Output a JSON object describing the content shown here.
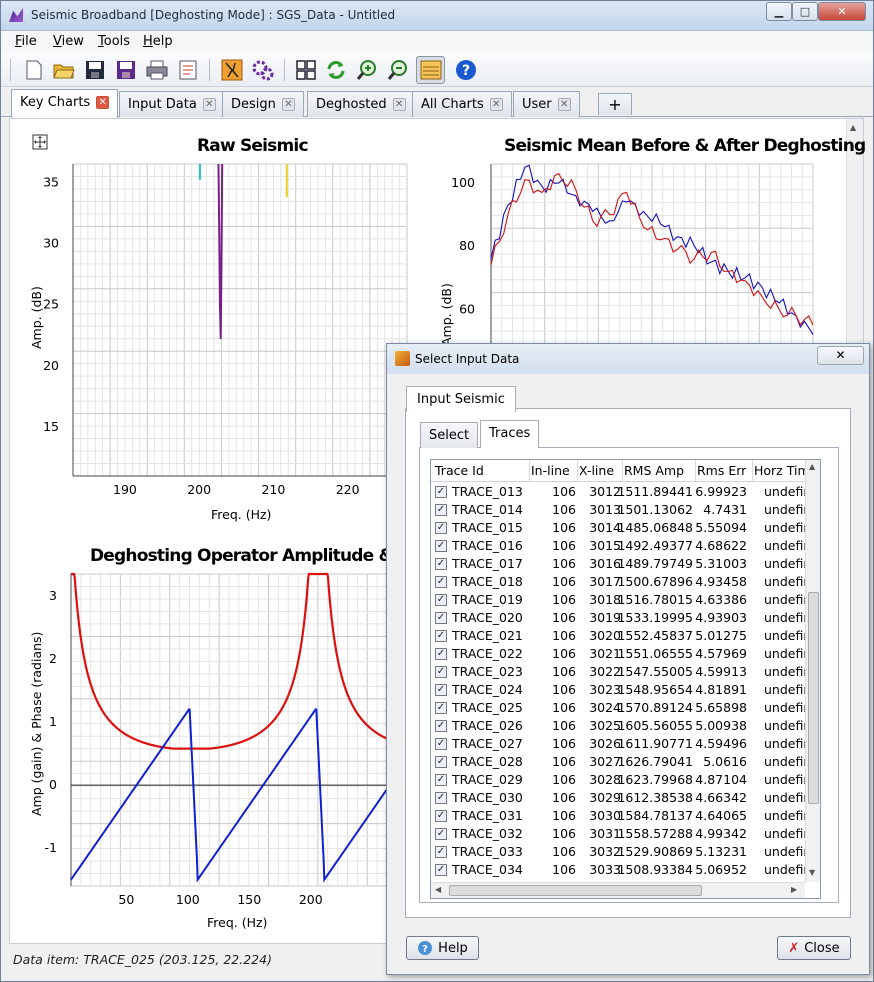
{
  "window": {
    "title": "Seismic Broadband [Deghosting Mode] : SGS_Data - Untitled",
    "min": "▁",
    "max": "□",
    "close": "✕"
  },
  "menu": [
    {
      "label": "File",
      "key": "F",
      "rest": "ile"
    },
    {
      "label": "View",
      "key": "V",
      "rest": "iew"
    },
    {
      "label": "Tools",
      "key": "T",
      "rest": "ools"
    },
    {
      "label": "Help",
      "key": "H",
      "rest": "elp"
    }
  ],
  "toolbar": {
    "icons": [
      "new-icon",
      "open-icon",
      "save-icon",
      "save-as-icon",
      "print-icon",
      "report-icon",
      "pick-icon",
      "process-icon",
      "grid-icon",
      "refresh-icon",
      "zoom-in-icon",
      "zoom-out-icon",
      "layers-icon",
      "help-icon"
    ]
  },
  "tabs": [
    {
      "label": "Key Charts",
      "active": true
    },
    {
      "label": "Input Data"
    },
    {
      "label": "Design"
    },
    {
      "label": "Deghosted"
    },
    {
      "label": "All Charts"
    },
    {
      "label": "User"
    }
  ],
  "tab_add": "+",
  "status": "Data item: TRACE_025 (203.125, 22.224)",
  "chart_data": [
    {
      "type": "line",
      "title": "Raw Seismic",
      "xlabel": "Freq. (Hz)",
      "ylabel": "Amp. (dB)",
      "xticks": [
        "190",
        "200",
        "210",
        "220"
      ],
      "yticks": [
        "15",
        "20",
        "25",
        "30",
        "35"
      ],
      "xlim": [
        183,
        228
      ],
      "ylim": [
        11,
        36.5
      ],
      "grid": true,
      "series": [
        {
          "color": "#7a1f8a",
          "x": [
            202.6,
            202.7,
            202.8,
            202.9,
            203.0,
            203.1
          ],
          "y": [
            36.5,
            31,
            25,
            22.2,
            28,
            36.5
          ]
        },
        {
          "color": "#20c0c0",
          "x": [
            200.1,
            200.1
          ],
          "y": [
            36.5,
            35.2
          ]
        },
        {
          "color": "#e8d020",
          "x": [
            211.8,
            211.8
          ],
          "y": [
            36.5,
            33.8
          ]
        }
      ]
    },
    {
      "type": "line",
      "title": "Seismic Mean Before & After Deghosting",
      "xlabel": "",
      "ylabel": "Amp. (dB)",
      "yticks": [
        "60",
        "80",
        "100"
      ],
      "ylim": [
        49,
        106
      ],
      "grid": true,
      "series": [
        {
          "color": "#1010c0",
          "y": [
            76,
            93,
            105,
            99,
            100,
            96,
            91,
            88,
            94,
            91,
            87,
            83,
            80,
            75,
            72,
            70,
            67,
            62,
            58,
            52
          ]
        },
        {
          "color": "#d01010",
          "y": [
            74,
            90,
            101,
            97,
            103,
            98,
            88,
            90,
            97,
            86,
            82,
            79,
            76,
            78,
            72,
            69,
            64,
            60,
            58,
            55
          ]
        }
      ]
    },
    {
      "type": "line",
      "title": "Deghosting Operator Amplitude & Phase",
      "xlabel": "Freq. (Hz)",
      "ylabel": "Amp (gain) & Phase (radians)",
      "xticks": [
        "50",
        "100",
        "150",
        "200"
      ],
      "yticks": [
        "-1",
        "0",
        "1",
        "2",
        "3"
      ],
      "xlim": [
        5,
        262
      ],
      "ylim": [
        -1.6,
        3.35
      ],
      "grid": true,
      "series": [
        {
          "name": "",
          "color": "#dd1010",
          "role": "amp"
        },
        {
          "name": "",
          "color": "#1020d0",
          "role": "phase"
        }
      ]
    }
  ],
  "dialog": {
    "title": "Select Input Data",
    "close": "✕",
    "outer_tab": "Input Seismic",
    "inner_tabs": [
      "Select",
      "Traces"
    ],
    "columns": [
      "Trace Id",
      "In-line",
      "X-line",
      "RMS Amp",
      "Rms Err",
      "Horz Tim"
    ],
    "rows": [
      [
        "TRACE_013",
        "106",
        "3012",
        "1511.89441",
        "6.99923",
        "undefir"
      ],
      [
        "TRACE_014",
        "106",
        "3013",
        "1501.13062",
        "4.7431",
        "undefir"
      ],
      [
        "TRACE_015",
        "106",
        "3014",
        "1485.06848",
        "5.55094",
        "undefir"
      ],
      [
        "TRACE_016",
        "106",
        "3015",
        "1492.49377",
        "4.68622",
        "undefir"
      ],
      [
        "TRACE_017",
        "106",
        "3016",
        "1489.79749",
        "5.31003",
        "undefir"
      ],
      [
        "TRACE_018",
        "106",
        "3017",
        "1500.67896",
        "4.93458",
        "undefir"
      ],
      [
        "TRACE_019",
        "106",
        "3018",
        "1516.78015",
        "4.63386",
        "undefir"
      ],
      [
        "TRACE_020",
        "106",
        "3019",
        "1533.19995",
        "4.93903",
        "undefir"
      ],
      [
        "TRACE_021",
        "106",
        "3020",
        "1552.45837",
        "5.01275",
        "undefir"
      ],
      [
        "TRACE_022",
        "106",
        "3021",
        "1551.06555",
        "4.57969",
        "undefir"
      ],
      [
        "TRACE_023",
        "106",
        "3022",
        "1547.55005",
        "4.59913",
        "undefir"
      ],
      [
        "TRACE_024",
        "106",
        "3023",
        "1548.95654",
        "4.81891",
        "undefir"
      ],
      [
        "TRACE_025",
        "106",
        "3024",
        "1570.89124",
        "5.65898",
        "undefir"
      ],
      [
        "TRACE_026",
        "106",
        "3025",
        "1605.56055",
        "5.00938",
        "undefir"
      ],
      [
        "TRACE_027",
        "106",
        "3026",
        "1611.90771",
        "4.59496",
        "undefir"
      ],
      [
        "TRACE_028",
        "106",
        "3027",
        "1626.79041",
        "5.0616",
        "undefir"
      ],
      [
        "TRACE_029",
        "106",
        "3028",
        "1623.79968",
        "4.87104",
        "undefir"
      ],
      [
        "TRACE_030",
        "106",
        "3029",
        "1612.38538",
        "4.66342",
        "undefir"
      ],
      [
        "TRACE_031",
        "106",
        "3030",
        "1584.78137",
        "4.64065",
        "undefir"
      ],
      [
        "TRACE_032",
        "106",
        "3031",
        "1558.57288",
        "4.99342",
        "undefir"
      ],
      [
        "TRACE_033",
        "106",
        "3032",
        "1529.90869",
        "5.13231",
        "undefir"
      ],
      [
        "TRACE_034",
        "106",
        "3033",
        "1508.93384",
        "5.06952",
        "undefir"
      ]
    ],
    "help": "Help",
    "close_btn": "Close"
  }
}
